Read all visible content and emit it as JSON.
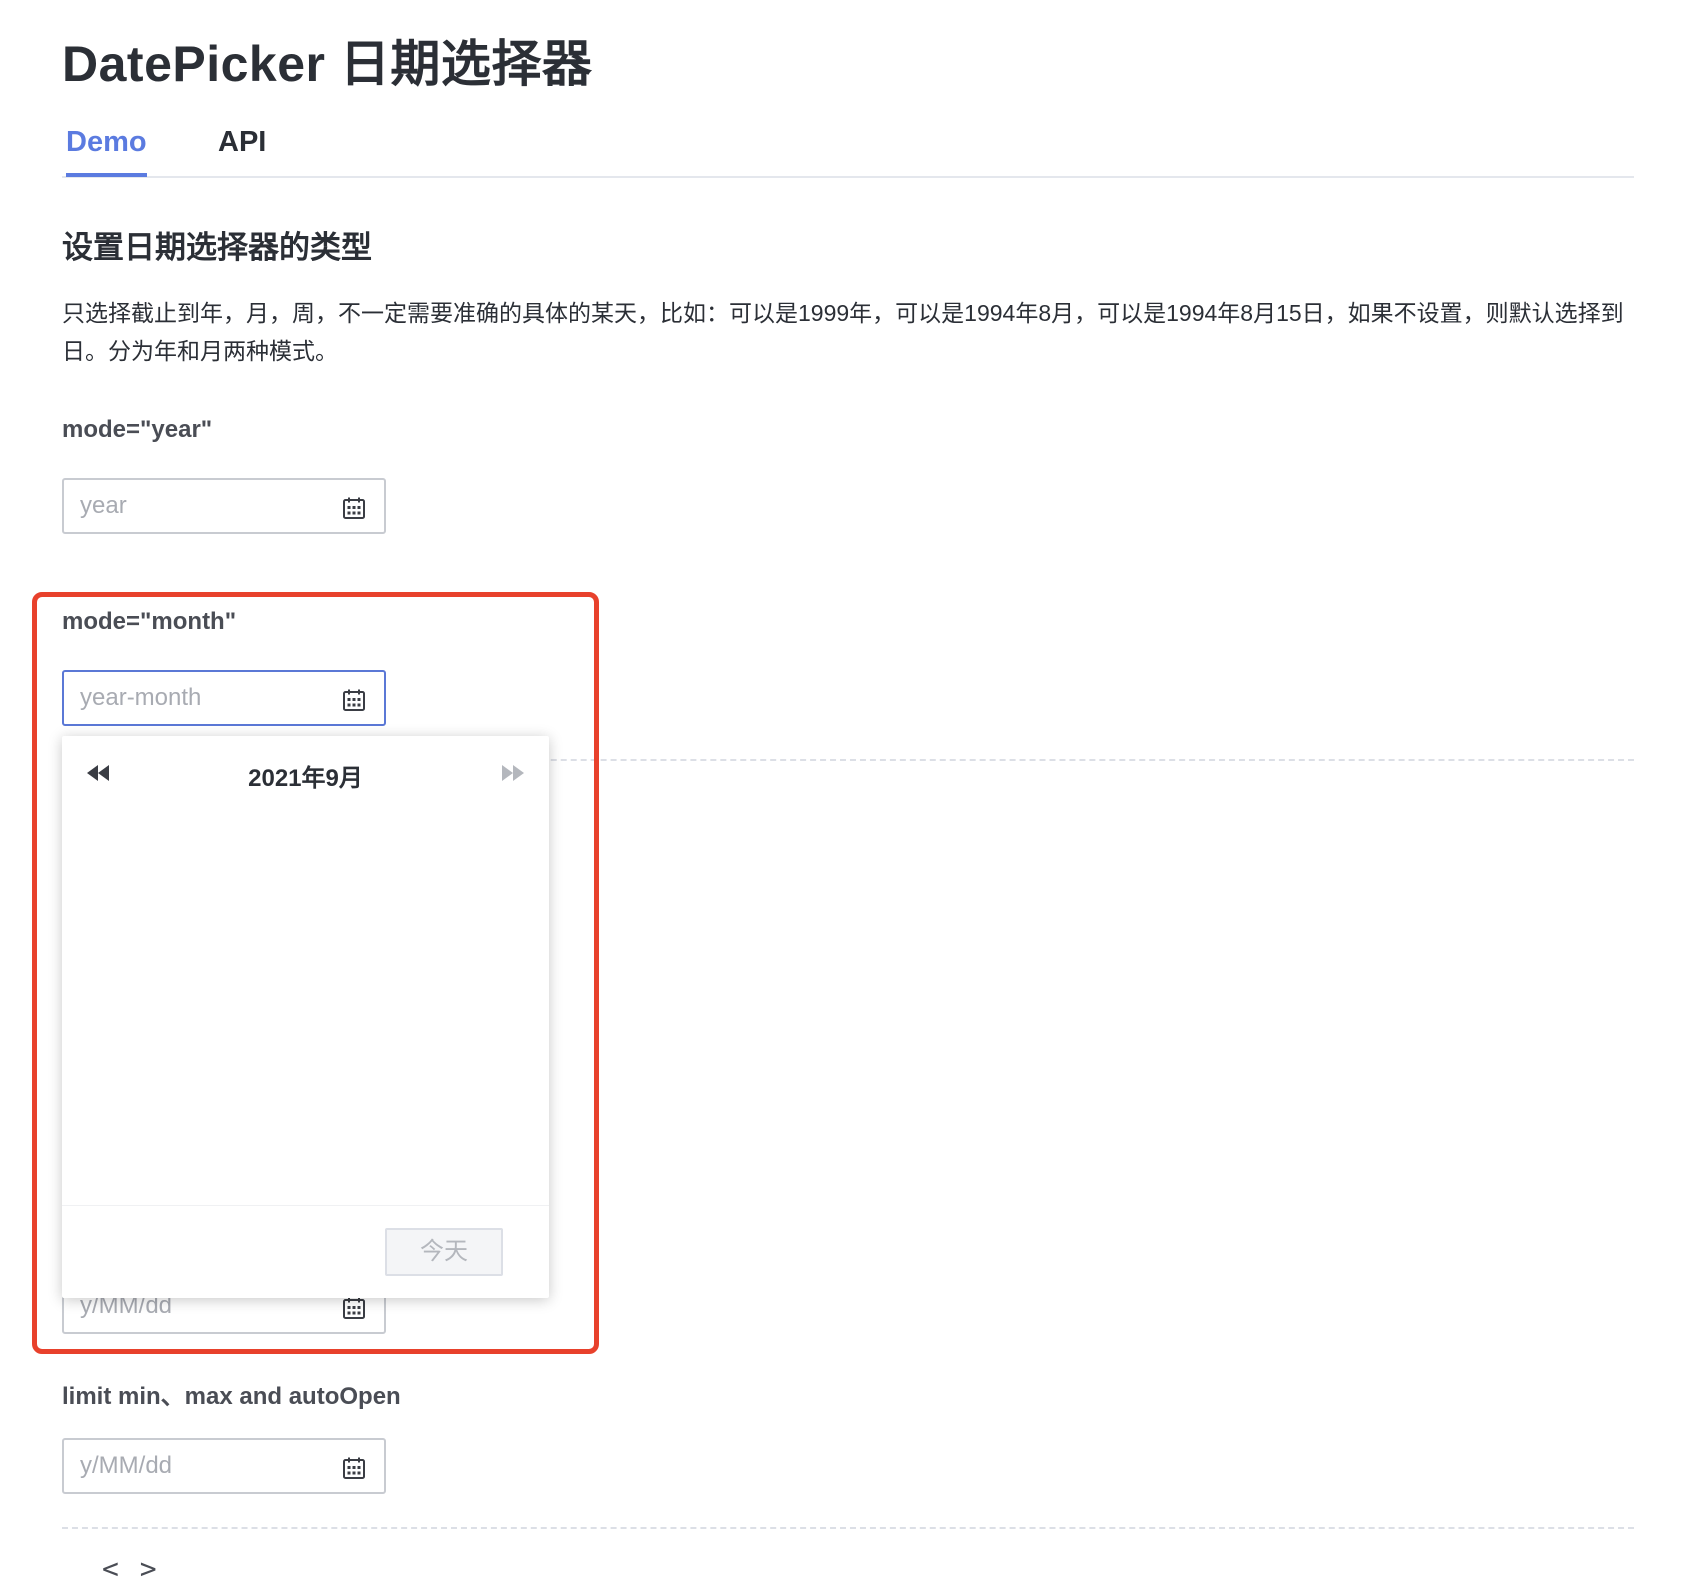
{
  "page": {
    "title": "DatePicker 日期选择器"
  },
  "tabs": [
    {
      "label": "Demo",
      "active": true
    },
    {
      "label": "API",
      "active": false
    }
  ],
  "section": {
    "title": "设置日期选择器的类型",
    "description": "只选择截止到年，月，周，不一定需要准确的具体的某天，比如：可以是1999年，可以是1994年8月，可以是1994年8月15日，如果不设置，则默认选择到日。分为年和月两种模式。"
  },
  "demos": {
    "year": {
      "label": "mode=\"year\"",
      "placeholder": "year"
    },
    "month": {
      "label": "mode=\"month\"",
      "placeholder": "year-month"
    },
    "day": {
      "placeholder": "y/MM/dd"
    },
    "limit": {
      "label": "limit min、max and autoOpen",
      "placeholder": "y/MM/dd"
    }
  },
  "popup": {
    "header_title": "2021年9月",
    "today_label": "今天"
  },
  "code_toggle": {
    "label": "< >"
  },
  "colors": {
    "accent": "#5b7be0",
    "highlight": "#e8412c",
    "text": "#2b2f36"
  },
  "icons": {
    "input_icon": "calendar-icon",
    "prev": "double-chevron-left-icon",
    "next": "double-chevron-right-icon"
  }
}
